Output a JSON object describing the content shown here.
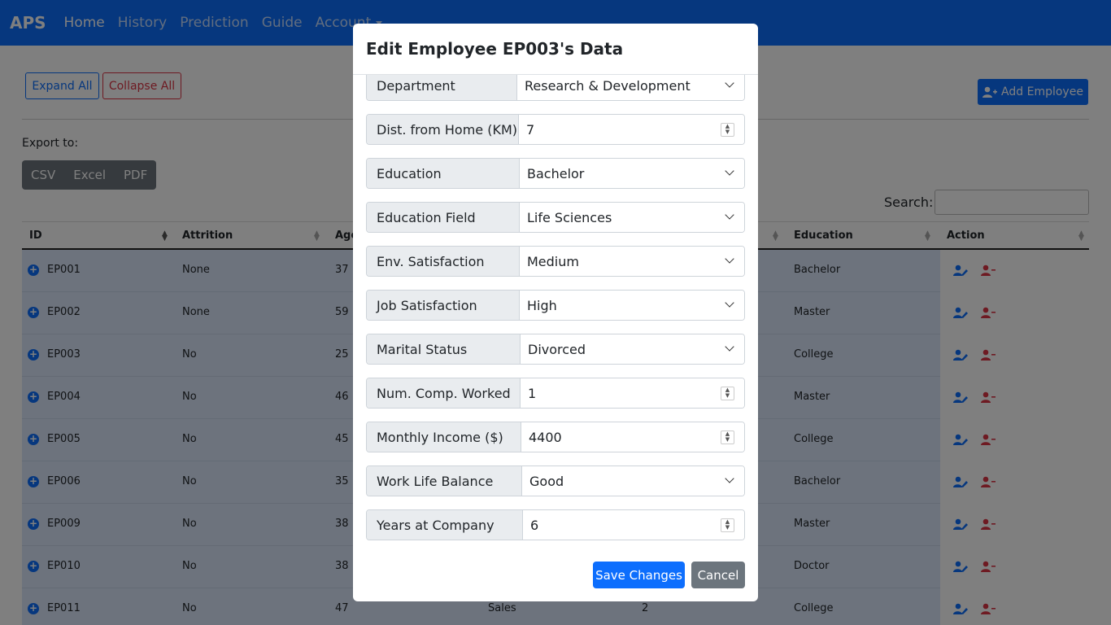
{
  "nav": {
    "brand": "APS",
    "links": [
      "Home",
      "History",
      "Prediction",
      "Guide",
      "Account"
    ]
  },
  "page": {
    "expand_all": "Expand All",
    "collapse_all": "Collapse All",
    "add_employee": "Add Employee",
    "export_label": "Export to:",
    "export_buttons": [
      "CSV",
      "Excel",
      "PDF"
    ],
    "search_label": "Search:",
    "search_value": ""
  },
  "table": {
    "headers": [
      "ID",
      "Attrition",
      "Age",
      "Education",
      "Action"
    ],
    "rows": [
      {
        "id": "EP001",
        "attrition": "None",
        "age": "37",
        "dept": "",
        "num": "",
        "education": "Bachelor"
      },
      {
        "id": "EP002",
        "attrition": "None",
        "age": "59",
        "dept": "",
        "num": "",
        "education": "Master"
      },
      {
        "id": "EP003",
        "attrition": "No",
        "age": "25",
        "dept": "",
        "num": "",
        "education": "College"
      },
      {
        "id": "EP004",
        "attrition": "No",
        "age": "46",
        "dept": "",
        "num": "",
        "education": "Master"
      },
      {
        "id": "EP005",
        "attrition": "No",
        "age": "45",
        "dept": "",
        "num": "",
        "education": "College"
      },
      {
        "id": "EP006",
        "attrition": "No",
        "age": "35",
        "dept": "",
        "num": "",
        "education": "Bachelor"
      },
      {
        "id": "EP009",
        "attrition": "No",
        "age": "38",
        "dept": "",
        "num": "",
        "education": "Master"
      },
      {
        "id": "EP010",
        "attrition": "No",
        "age": "38",
        "dept": "",
        "num": "",
        "education": "Doctor"
      },
      {
        "id": "EP011",
        "attrition": "No",
        "age": "47",
        "dept": "Sales",
        "num": "2",
        "education": "College"
      }
    ]
  },
  "modal": {
    "title": "Edit Employee EP003's Data",
    "fields": [
      {
        "label": "Department",
        "value": "Research & Development",
        "kind": "select"
      },
      {
        "label": "Dist. from Home (KM)",
        "value": "7",
        "kind": "number"
      },
      {
        "label": "Education",
        "value": "Bachelor",
        "kind": "select"
      },
      {
        "label": "Education Field",
        "value": "Life Sciences",
        "kind": "select"
      },
      {
        "label": "Env. Satisfaction",
        "value": "Medium",
        "kind": "select"
      },
      {
        "label": "Job Satisfaction",
        "value": "High",
        "kind": "select"
      },
      {
        "label": "Marital Status",
        "value": "Divorced",
        "kind": "select"
      },
      {
        "label": "Num. Comp. Worked",
        "value": "1",
        "kind": "number"
      },
      {
        "label": "Monthly Income ($)",
        "value": "4400",
        "kind": "number"
      },
      {
        "label": "Work Life Balance",
        "value": "Good",
        "kind": "select"
      },
      {
        "label": "Years at Company",
        "value": "6",
        "kind": "number"
      }
    ],
    "save_label": "Save Changes",
    "cancel_label": "Cancel"
  }
}
